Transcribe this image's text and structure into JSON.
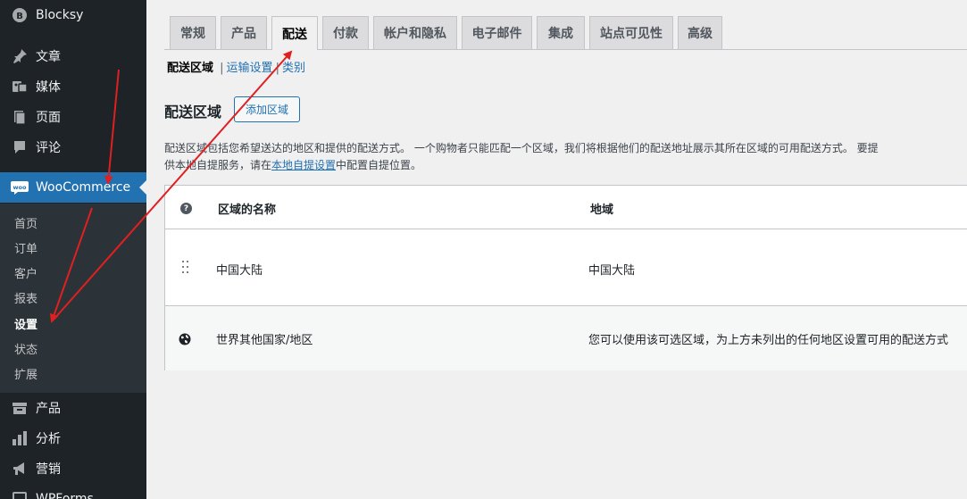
{
  "sidebar": {
    "site_name": "Blocksy",
    "items": [
      {
        "label": "文章",
        "icon": "pin-icon"
      },
      {
        "label": "媒体",
        "icon": "media-icon"
      },
      {
        "label": "页面",
        "icon": "page-icon"
      },
      {
        "label": "评论",
        "icon": "comment-icon"
      },
      {
        "label": "WooCommerce",
        "icon": "woo-icon"
      },
      {
        "label": "产品",
        "icon": "product-icon"
      },
      {
        "label": "分析",
        "icon": "analytics-icon"
      },
      {
        "label": "营销",
        "icon": "megaphone-icon"
      },
      {
        "label": "WPForms",
        "icon": "forms-icon"
      }
    ],
    "woo_submenu": [
      "首页",
      "订单",
      "客户",
      "报表",
      "设置",
      "状态",
      "扩展"
    ],
    "woo_badge": "woo"
  },
  "tabs": [
    "常规",
    "产品",
    "配送",
    "付款",
    "帐户和隐私",
    "电子邮件",
    "集成",
    "站点可见性",
    "高级"
  ],
  "active_tab": "配送",
  "subnav": {
    "current": "配送区域",
    "links": [
      "运输设置",
      "类别"
    ],
    "separator": "|"
  },
  "heading": "配送区域",
  "add_zone_button": "添加区域",
  "description": {
    "part1": "配送区域包括您希望送达的地区和提供的配送方式。 一个购物者只能匹配一个区域，我们将根据他们的配送地址展示其所在区域的可用配送方式。 要提供本地自提服务，请在",
    "link": "本地自提设置",
    "part2": "中配置自提位置。"
  },
  "table": {
    "help_glyph": "?",
    "col_name": "区域的名称",
    "col_region": "地域",
    "rows": [
      {
        "name": "中国大陆",
        "region": "中国大陆"
      },
      {
        "name": "世界其他国家/地区",
        "region": "您可以使用该可选区域，为上方未列出的任何地区设置可用的配送方式"
      }
    ]
  },
  "colors": {
    "sidebar_bg": "#1d2327",
    "submenu_bg": "#2c3338",
    "accent": "#2271b1",
    "annotation_red": "#e02020"
  }
}
